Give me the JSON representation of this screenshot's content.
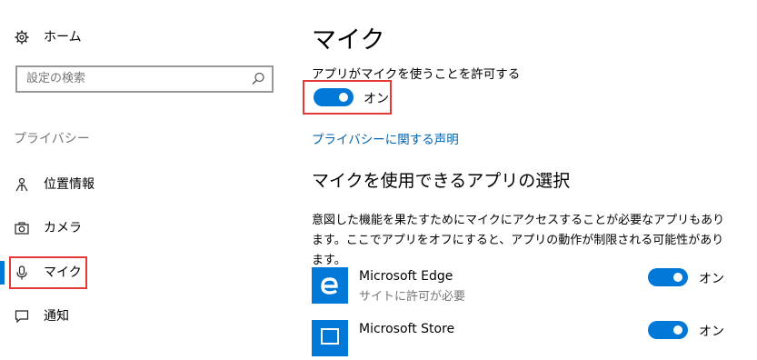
{
  "sidebar": {
    "home_label": "ホーム",
    "search_placeholder": "設定の検索",
    "section_label": "プライバシー",
    "items": [
      {
        "label": "位置情報",
        "icon": "location-icon"
      },
      {
        "label": "カメラ",
        "icon": "camera-icon"
      },
      {
        "label": "マイク",
        "icon": "microphone-icon"
      },
      {
        "label": "通知",
        "icon": "notification-icon"
      }
    ]
  },
  "main": {
    "title": "マイク",
    "allow_label": "アプリがマイクを使うことを許可する",
    "allow_toggle_state": "オン",
    "privacy_link": "プライバシーに関する声明",
    "choose_heading": "マイクを使用できるアプリの選択",
    "description": "意図した機能を果たすためにマイクにアクセスすることが必要なアプリもあります。ここでアプリをオフにすると、アプリの動作が制限される可能性があります。",
    "apps": [
      {
        "name": "Microsoft Edge",
        "status": "サイトに許可が必要",
        "toggle_state": "オン",
        "icon": "edge-icon"
      },
      {
        "name": "Microsoft Store",
        "toggle_state": "オン",
        "icon": "store-icon"
      }
    ]
  },
  "colors": {
    "accent": "#0078d7",
    "highlight": "#e53935",
    "link": "#0063b1"
  }
}
